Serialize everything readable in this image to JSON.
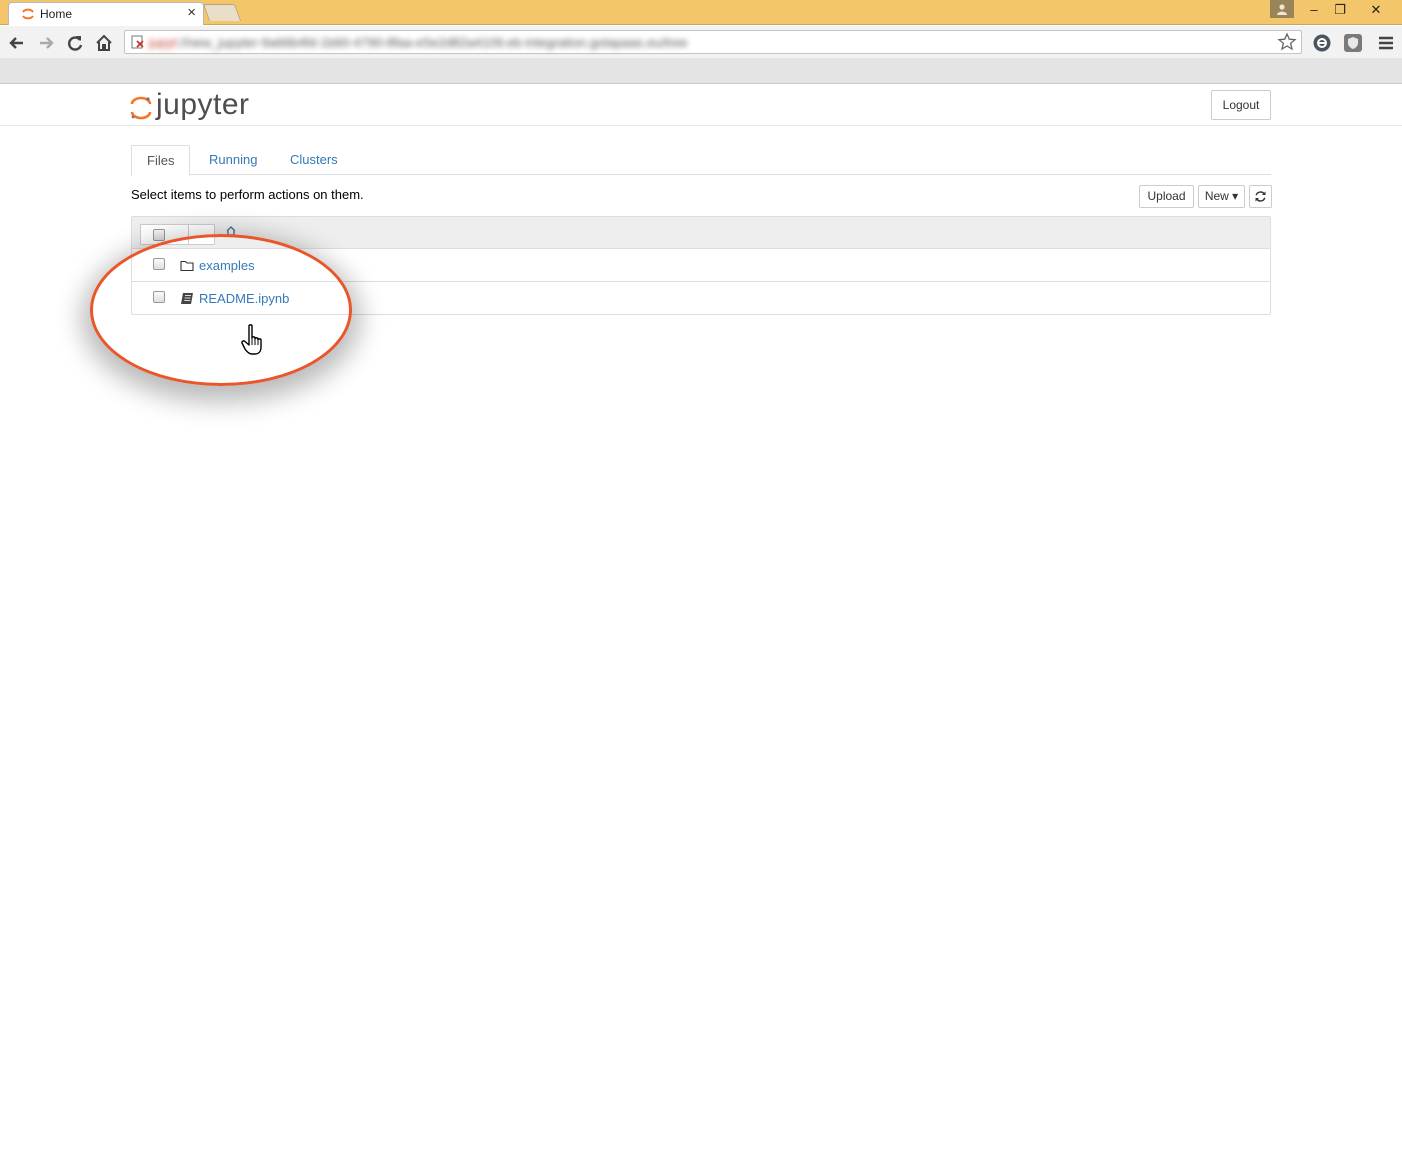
{
  "browser": {
    "tab_title": "Home",
    "tab_close": "×",
    "address_scheme": "jupyt",
    "address_rest": "://new_jupyter-9a66b4fd-1b60-4790-8faa-e5e2d82a4109.eb-integration.gotapaas.eu/tree",
    "window_controls": {
      "minimize": "–",
      "restore": "❐",
      "close": "✕"
    }
  },
  "header": {
    "logo_text": "jupyter",
    "logout_label": "Logout"
  },
  "tabs": [
    {
      "label": "Files",
      "active": true
    },
    {
      "label": "Running",
      "active": false
    },
    {
      "label": "Clusters",
      "active": false
    }
  ],
  "toolbar": {
    "hint": "Select items to perform actions on them.",
    "upload_label": "Upload",
    "new_label": "New ▾",
    "refresh_icon": "refresh-icon"
  },
  "files": [
    {
      "name": "examples",
      "type": "folder",
      "icon": "folder-icon"
    },
    {
      "name": "README.ipynb",
      "type": "notebook",
      "icon": "notebook-icon"
    }
  ],
  "colors": {
    "accent_link": "#337ab7",
    "jupyter_orange": "#f37726",
    "callout": "#e8562a",
    "titlebar": "#f3c66b"
  }
}
